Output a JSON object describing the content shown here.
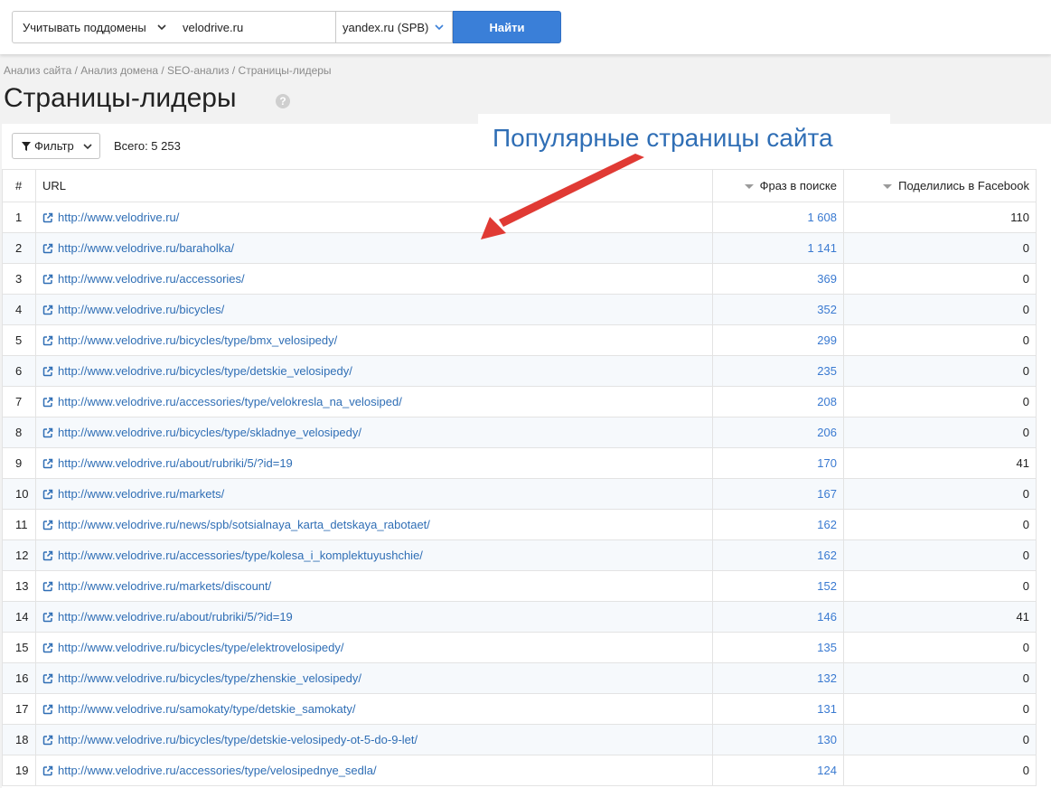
{
  "search": {
    "subdomains_label": "Учитывать поддомены",
    "domain_value": "velodrive.ru",
    "engine_label": "yandex.ru (SPB)",
    "submit_label": "Найти"
  },
  "breadcrumb": "Анализ сайта / Анализ домена / SEO-анализ / Страницы-лидеры",
  "page_title": "Страницы-лидеры",
  "help_glyph": "?",
  "toolbar": {
    "filter_label": "Фильтр",
    "total_label": "Всего: 5 253"
  },
  "annotation": "Популярные страницы сайта",
  "table": {
    "headers": {
      "index": "#",
      "url": "URL",
      "phrases": "Фраз в поиске",
      "facebook": "Поделились в Facebook"
    },
    "rows": [
      {
        "n": "1",
        "url": "http://www.velodrive.ru/",
        "phrases": "1 608",
        "fb": "110"
      },
      {
        "n": "2",
        "url": "http://www.velodrive.ru/baraholka/",
        "phrases": "1 141",
        "fb": "0"
      },
      {
        "n": "3",
        "url": "http://www.velodrive.ru/accessories/",
        "phrases": "369",
        "fb": "0"
      },
      {
        "n": "4",
        "url": "http://www.velodrive.ru/bicycles/",
        "phrases": "352",
        "fb": "0"
      },
      {
        "n": "5",
        "url": "http://www.velodrive.ru/bicycles/type/bmx_velosipedy/",
        "phrases": "299",
        "fb": "0"
      },
      {
        "n": "6",
        "url": "http://www.velodrive.ru/bicycles/type/detskie_velosipedy/",
        "phrases": "235",
        "fb": "0"
      },
      {
        "n": "7",
        "url": "http://www.velodrive.ru/accessories/type/velokresla_na_velosiped/",
        "phrases": "208",
        "fb": "0"
      },
      {
        "n": "8",
        "url": "http://www.velodrive.ru/bicycles/type/skladnye_velosipedy/",
        "phrases": "206",
        "fb": "0"
      },
      {
        "n": "9",
        "url": "http://www.velodrive.ru/about/rubriki/5/?id=19",
        "phrases": "170",
        "fb": "41"
      },
      {
        "n": "10",
        "url": "http://www.velodrive.ru/markets/",
        "phrases": "167",
        "fb": "0"
      },
      {
        "n": "11",
        "url": "http://www.velodrive.ru/news/spb/sotsialnaya_karta_detskaya_rabotaet/",
        "phrases": "162",
        "fb": "0"
      },
      {
        "n": "12",
        "url": "http://www.velodrive.ru/accessories/type/kolesa_i_komplektuyushchie/",
        "phrases": "162",
        "fb": "0"
      },
      {
        "n": "13",
        "url": "http://www.velodrive.ru/markets/discount/",
        "phrases": "152",
        "fb": "0"
      },
      {
        "n": "14",
        "url": "http://www.velodrive.ru/about/rubriki/5/?id=19",
        "phrases": "146",
        "fb": "41"
      },
      {
        "n": "15",
        "url": "http://www.velodrive.ru/bicycles/type/elektrovelosipedy/",
        "phrases": "135",
        "fb": "0"
      },
      {
        "n": "16",
        "url": "http://www.velodrive.ru/bicycles/type/zhenskie_velosipedy/",
        "phrases": "132",
        "fb": "0"
      },
      {
        "n": "17",
        "url": "http://www.velodrive.ru/samokaty/type/detskie_samokaty/",
        "phrases": "131",
        "fb": "0"
      },
      {
        "n": "18",
        "url": "http://www.velodrive.ru/bicycles/type/detskie-velosipedy-ot-5-do-9-let/",
        "phrases": "130",
        "fb": "0"
      },
      {
        "n": "19",
        "url": "http://www.velodrive.ru/accessories/type/velosipednye_sedla/",
        "phrases": "124",
        "fb": "0"
      }
    ]
  },
  "colors": {
    "accent": "#3a7fd8",
    "link": "#2f6eb5",
    "annotation_arrow": "#e03a34"
  },
  "icons": {
    "row_link": "external-link-icon",
    "filter": "funnel-icon",
    "help": "question-circle-icon",
    "dropdown": "chevron-down-icon"
  }
}
